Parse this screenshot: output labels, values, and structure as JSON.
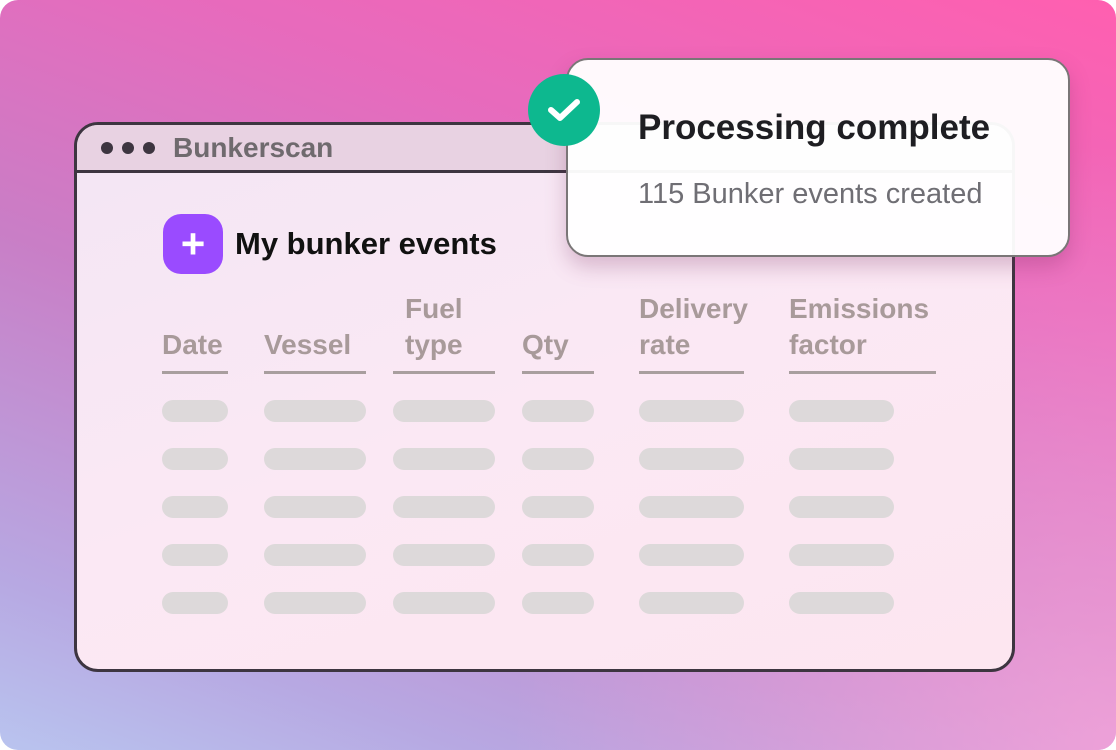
{
  "window": {
    "title": "Bunkerscan"
  },
  "page": {
    "heading": "My bunker events",
    "add_icon": "plus-icon"
  },
  "table": {
    "columns": [
      {
        "label": "Date"
      },
      {
        "label": "Vessel"
      },
      {
        "label": "Fuel type"
      },
      {
        "label": "Qty"
      },
      {
        "label": "Delivery rate"
      },
      {
        "label": "Emissions factor"
      }
    ],
    "placeholder_rows": 5
  },
  "toast": {
    "title": "Processing complete",
    "message": "115 Bunker events created",
    "icon": "check-icon",
    "icon_color": "#0db88f"
  },
  "colors": {
    "accent": "#9a4bff",
    "success": "#0db88f"
  }
}
